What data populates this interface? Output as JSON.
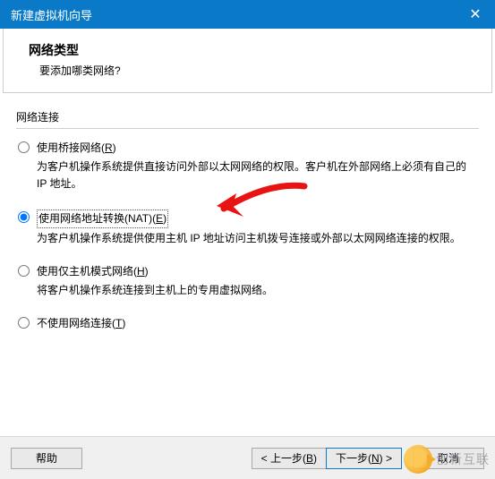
{
  "window": {
    "title": "新建虚拟机向导"
  },
  "header": {
    "title": "网络类型",
    "subtitle": "要添加哪类网络?"
  },
  "fieldset_label": "网络连接",
  "options": {
    "bridged": {
      "label_pre": "使用桥接网络(",
      "mnemonic": "R",
      "label_post": ")",
      "desc": "为客户机操作系统提供直接访问外部以太网网络的权限。客户机在外部网络上必须有自己的 IP 地址。"
    },
    "nat": {
      "label_pre": "使用网络地址转换(NAT)(",
      "mnemonic": "E",
      "label_post": ")",
      "desc": "为客户机操作系统提供使用主机 IP 地址访问主机拨号连接或外部以太网网络连接的权限。"
    },
    "hostonly": {
      "label_pre": "使用仅主机模式网络(",
      "mnemonic": "H",
      "label_post": ")",
      "desc": "将客户机操作系统连接到主机上的专用虚拟网络。"
    },
    "none": {
      "label_pre": "不使用网络连接(",
      "mnemonic": "T",
      "label_post": ")"
    }
  },
  "buttons": {
    "help": "帮助",
    "back_pre": "< 上一步(",
    "back_m": "B",
    "back_post": ")",
    "next_pre": "下一步(",
    "next_m": "N",
    "next_post": ") >",
    "cancel": "取消"
  },
  "watermark": "创新互联"
}
